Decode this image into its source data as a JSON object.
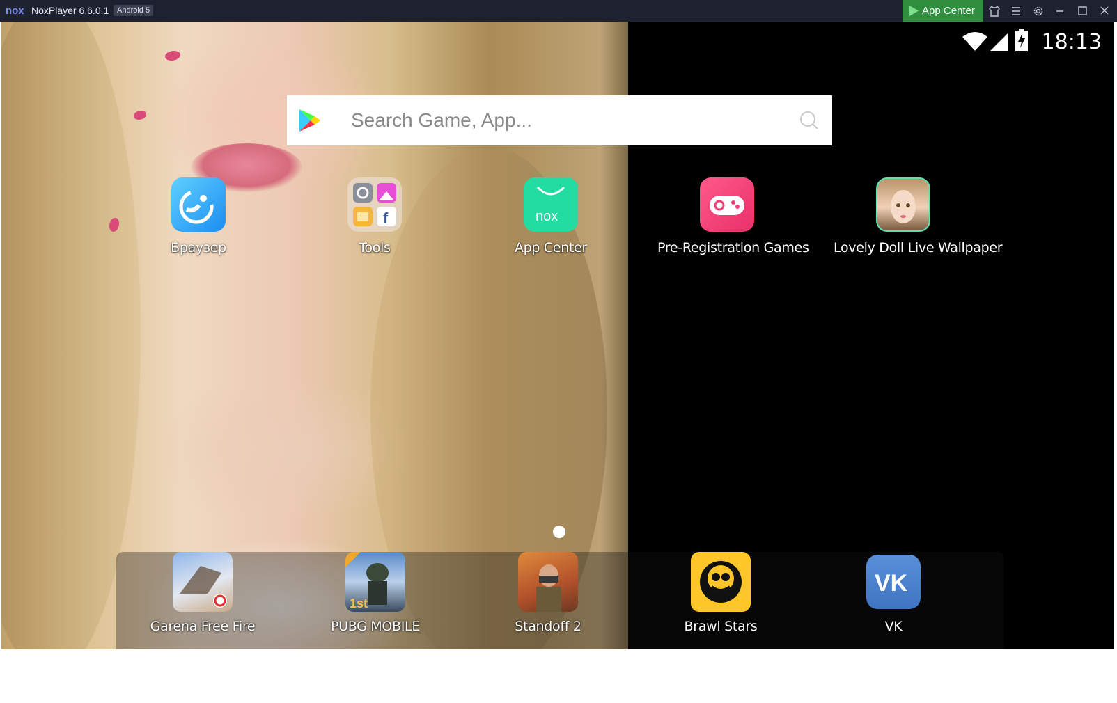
{
  "window": {
    "title": "NoxPlayer 6.6.0.1",
    "android_badge": "Android 5",
    "app_center_button": "App Center"
  },
  "status_bar": {
    "time": "18:13"
  },
  "search": {
    "placeholder": "Search Game, App..."
  },
  "home_apps": [
    {
      "label": "Браузер",
      "icon": "browser-icon"
    },
    {
      "label": "Tools",
      "icon": "tools-folder-icon"
    },
    {
      "label": "App Center",
      "icon": "nox-app-center-icon"
    },
    {
      "label": "Pre-Registration Games",
      "icon": "gamepad-icon"
    },
    {
      "label": "Lovely Doll Live Wallpaper",
      "icon": "doll-wallpaper-icon"
    }
  ],
  "dock_apps": [
    {
      "label": "Garena Free Fire",
      "icon": "free-fire-icon"
    },
    {
      "label": "PUBG MOBILE",
      "icon": "pubg-icon"
    },
    {
      "label": "Standoff 2",
      "icon": "standoff-icon"
    },
    {
      "label": "Brawl Stars",
      "icon": "brawl-stars-icon"
    },
    {
      "label": "VK",
      "icon": "vk-icon"
    }
  ],
  "colors": {
    "titlebar": "#1d2130",
    "app_center_green": "#2f8f3e",
    "screen_background": "#000000"
  }
}
